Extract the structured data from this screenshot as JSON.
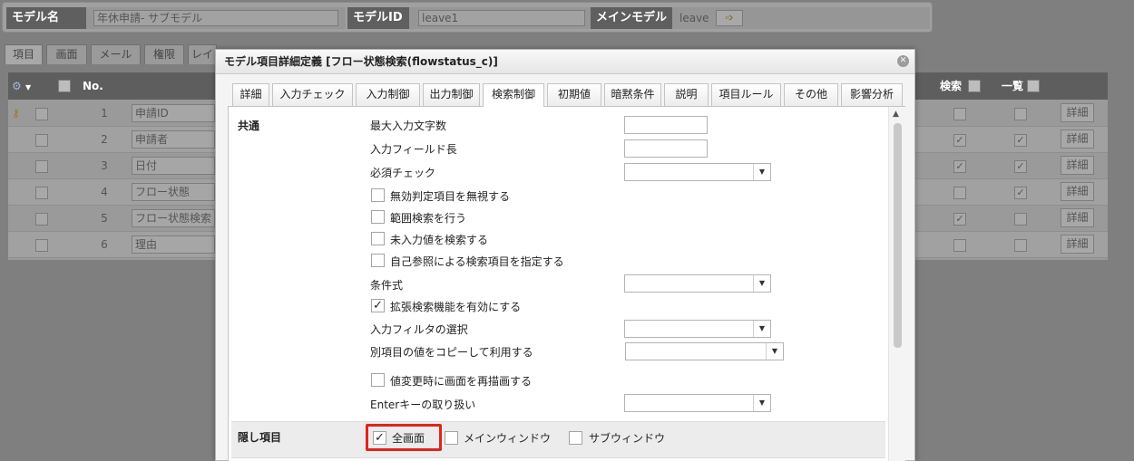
{
  "header": {
    "model_name_label": "モデル名",
    "model_name_value": "年休申請- サブモデル",
    "model_id_label": "モデルID",
    "model_id_value": "leave1",
    "main_model_label": "メインモデル",
    "main_model_value": "leave"
  },
  "bg_tabs": [
    "項目",
    "画面",
    "メール",
    "権限",
    "レイ"
  ],
  "bg_table": {
    "headers": {
      "no": "No.",
      "search": "検索",
      "list": "一覧"
    },
    "detail_label": "詳細",
    "rows": [
      {
        "no": "1",
        "name": "申請ID",
        "search": false,
        "list": false
      },
      {
        "no": "2",
        "name": "申請者",
        "search": true,
        "list": true
      },
      {
        "no": "3",
        "name": "日付",
        "search": true,
        "list": true
      },
      {
        "no": "4",
        "name": "フロー状態",
        "search": false,
        "list": true
      },
      {
        "no": "5",
        "name": "フロー状態検索",
        "search": true,
        "list": false
      },
      {
        "no": "6",
        "name": "理由",
        "search": false,
        "list": false
      }
    ]
  },
  "dialog": {
    "title": "モデル項目詳細定義 [フロー状態検索(flowstatus_c)]",
    "tabs": [
      "詳細",
      "入力チェック",
      "入力制御",
      "出力制御",
      "検索制御",
      "初期値",
      "暗黙条件",
      "説明",
      "項目ルール",
      "その他",
      "影響分析"
    ],
    "active_tab": "検索制御",
    "common_label": "共通",
    "fields": {
      "max_input_chars": "最大入力文字数",
      "input_field_length": "入力フィールド長",
      "required_check": "必須チェック",
      "ignore_invalid": "無効判定項目を無視する",
      "range_search": "範囲検索を行う",
      "search_empty": "未入力値を検索する",
      "self_reference": "自己参照による検索項目を指定する",
      "condition": "条件式",
      "extended_search": "拡張検索機能を有効にする",
      "input_filter": "入力フィルタの選択",
      "copy_other": "別項目の値をコピーして利用する",
      "redraw_on_change": "値変更時に画面を再描画する",
      "enter_key": "Enterキーの取り扱い"
    },
    "checks": {
      "ignore_invalid": false,
      "range_search": false,
      "search_empty": false,
      "self_reference": false,
      "extended_search": true,
      "redraw_on_change": false
    },
    "hidden_items": {
      "label": "隠し項目",
      "full_screen": "全画面",
      "main_window": "メインウィンドウ",
      "sub_window": "サブウィンドウ",
      "full_screen_checked": true,
      "main_window_checked": false,
      "sub_window_checked": false
    }
  },
  "colors": {
    "highlight": "#e0241b",
    "overlay": "#7f7f7f"
  }
}
